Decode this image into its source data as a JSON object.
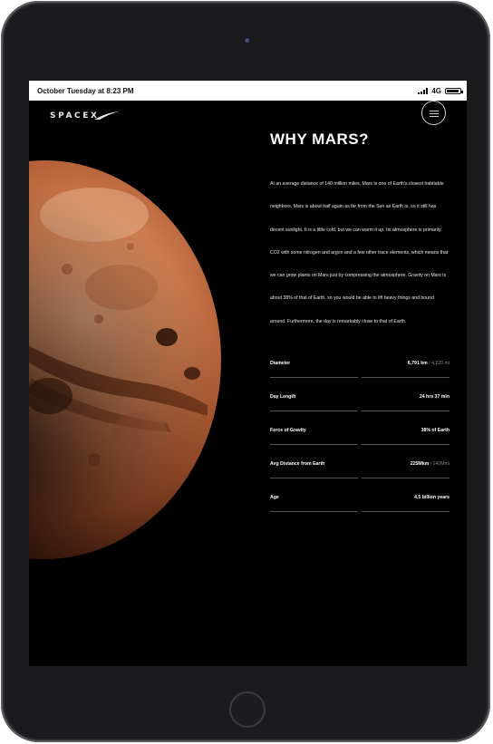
{
  "status_bar": {
    "time": "October Tuesday at 8:23 PM",
    "network": "4G"
  },
  "brand": {
    "logo_text": "SPACEX"
  },
  "page": {
    "title": "WHY MARS?",
    "paragraph": "At an average distance of 140 million miles, Mars is one of Earth's closest habitable neighbors. Mars is about half again as far from the Sun as Earth is, so it still has decent sunlight. It is a little cold, but we can warm it up. Its atmosphere is primarily CO2 with some nitrogen and argon and a few other trace elements, which means that we can grow plants on Mars just by compressing the atmosphere. Gravity on Mars is about 38% of that of Earth, so you would be able to lift heavy things and bound around. Furthermore, the day is remarkably close to that of Earth.",
    "stats": [
      {
        "label": "Diameter",
        "value": "6,791 km",
        "unit": " / 4,220 mi"
      },
      {
        "label": "Day Length",
        "value": "24 hrs 37 min",
        "unit": ""
      },
      {
        "label": "Force of Gravity",
        "value": "38% of Earth",
        "unit": ""
      },
      {
        "label": "Avg Distance from Earth",
        "value": "225Mkm",
        "unit": " / 140Mmi"
      },
      {
        "label": "Age",
        "value": "4.5 billion years",
        "unit": ""
      }
    ]
  },
  "icons": {
    "camera": "camera-icon",
    "home": "home-button-icon",
    "menu": "hamburger-menu-icon",
    "signal": "signal-bars-icon",
    "battery": "battery-icon"
  },
  "colors": {
    "background": "#000000",
    "device_frame": "#1b1b1e",
    "mars_orange": "#c9774a",
    "text": "#ffffff"
  }
}
